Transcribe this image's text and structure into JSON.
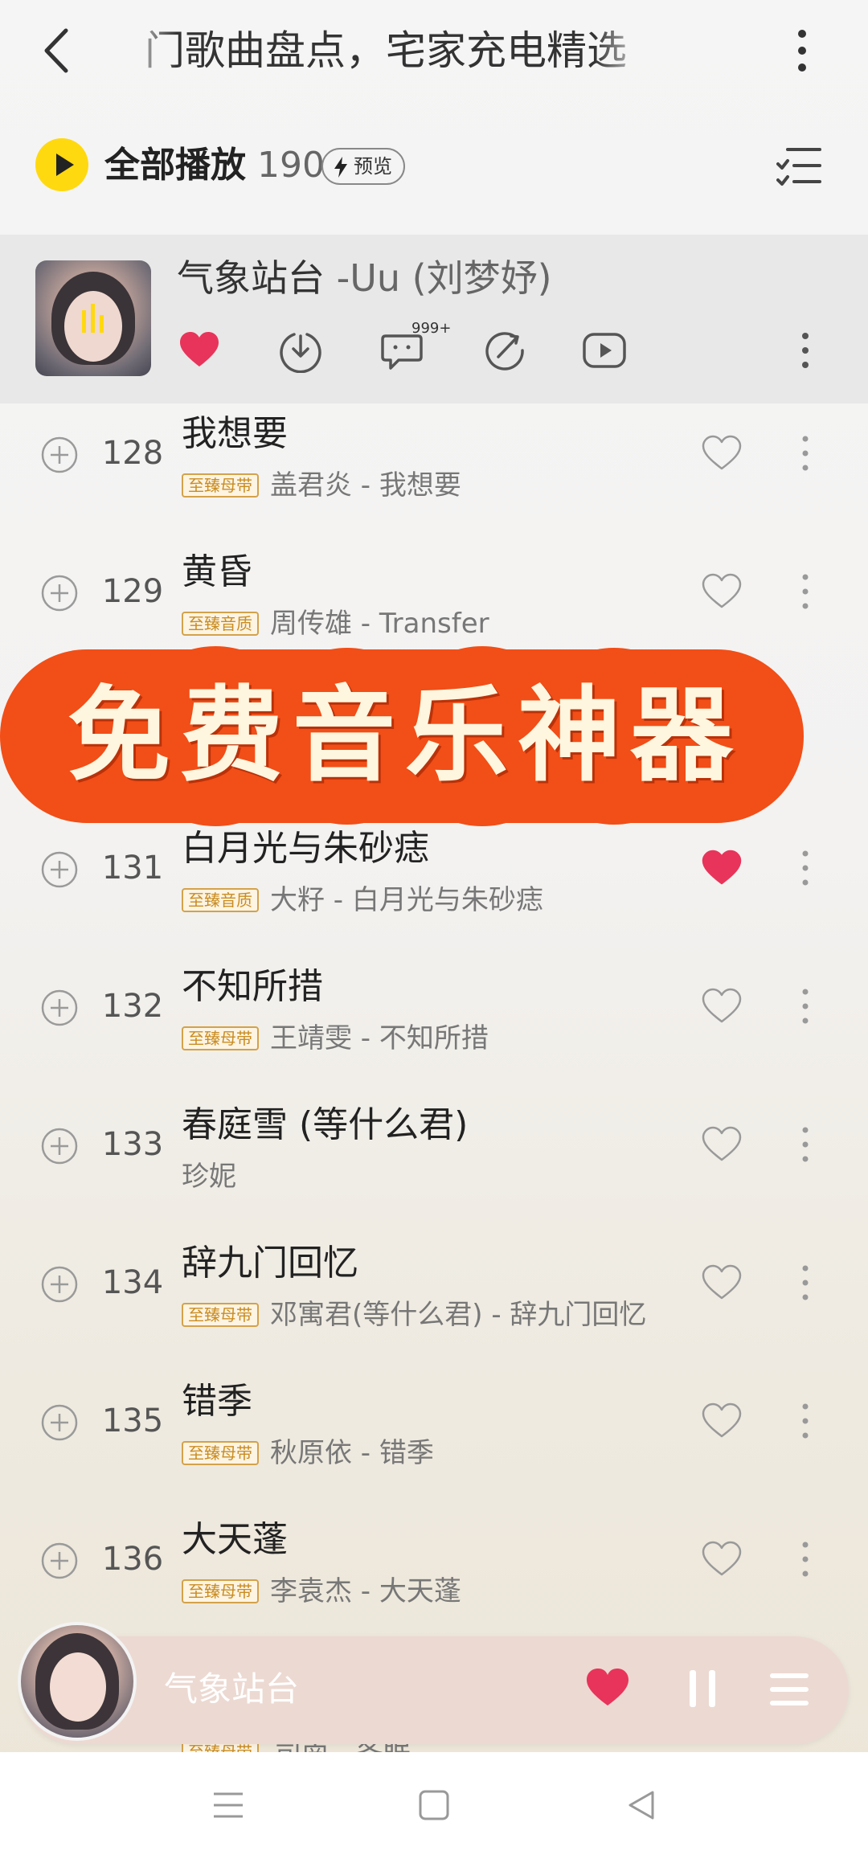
{
  "header": {
    "title": "门歌曲盘点，宅家充电精选",
    "back_icon": "chevron-left-icon",
    "more_icon": "vertical-dots-icon"
  },
  "playall": {
    "label": "全部播放",
    "count": "190",
    "preview_label": "预览",
    "accent": "#ffd90f"
  },
  "now_playing": {
    "title": "气象站台",
    "artist": "-Uu (刘梦妤)",
    "comment_badge": "999+",
    "liked": true
  },
  "songs": [
    {
      "num": "128",
      "title": "我想要",
      "quality": "至臻母带",
      "subtitle": "盖君炎 - 我想要",
      "liked": false
    },
    {
      "num": "129",
      "title": "黄昏",
      "quality": "至臻音质",
      "subtitle": "周传雄 - Transfer",
      "liked": false
    },
    {
      "num": "131",
      "title": "白月光与朱砂痣",
      "quality": "至臻音质",
      "subtitle": "大籽 - 白月光与朱砂痣",
      "liked": true
    },
    {
      "num": "132",
      "title": "不知所措",
      "quality": "至臻母带",
      "subtitle": "王靖雯 - 不知所措",
      "liked": false
    },
    {
      "num": "133",
      "title": "春庭雪 (等什么君)",
      "quality": "",
      "subtitle": "珍妮",
      "liked": false
    },
    {
      "num": "134",
      "title": "辞九门回忆",
      "quality": "至臻母带",
      "subtitle": "邓寓君(等什么君) - 辞九门回忆",
      "liked": false
    },
    {
      "num": "135",
      "title": "错季",
      "quality": "至臻母带",
      "subtitle": "秋原依 - 错季",
      "liked": false
    },
    {
      "num": "136",
      "title": "大天蓬",
      "quality": "至臻母带",
      "subtitle": "李袁杰 - 大天蓬",
      "liked": false
    }
  ],
  "promo": {
    "text": "免费音乐神器",
    "color": "#f24e17"
  },
  "mini_player": {
    "title": "气象站台",
    "peek_quality": "至臻母带",
    "peek_subtitle": "司南 - 冬眠",
    "heart_color": "#e8345a"
  },
  "colors": {
    "like_red": "#e8345a",
    "quality_gold": "#c98c22"
  }
}
